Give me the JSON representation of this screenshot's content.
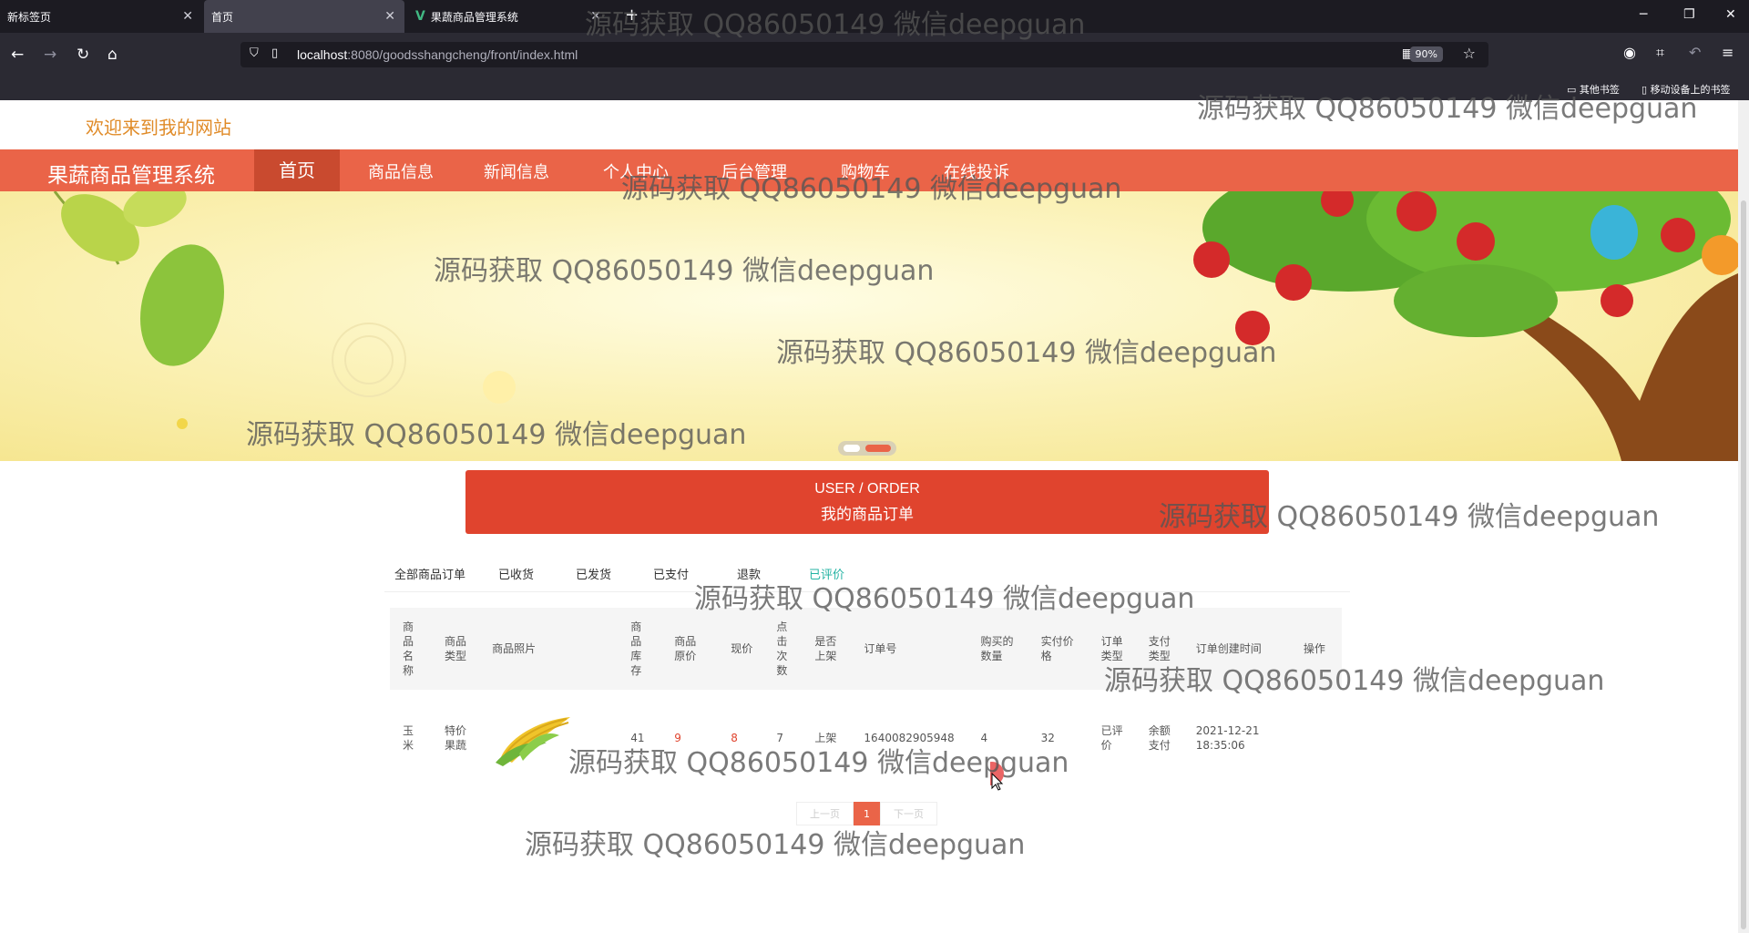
{
  "browser": {
    "tabs": [
      {
        "title": "新标签页"
      },
      {
        "title": "首页"
      },
      {
        "title": "果蔬商品管理系统"
      }
    ],
    "url_host": "localhost",
    "url_rest": ":8080/goodsshangcheng/front/index.html",
    "zoom": "90%",
    "bookmarks": [
      "其他书签",
      "移动设备上的书签"
    ]
  },
  "site": {
    "welcome": "欢迎来到我的网站",
    "brand": "果蔬商品管理系统",
    "menu": [
      "首页",
      "商品信息",
      "新闻信息",
      "个人中心",
      "后台管理",
      "购物车",
      "在线投诉"
    ],
    "active_menu_index": 0
  },
  "order_header": {
    "en": "USER / ORDER",
    "cn": "我的商品订单"
  },
  "status_tabs": [
    "全部商品订单",
    "已收货",
    "已发货",
    "已支付",
    "退款",
    "已评价"
  ],
  "active_status": "已评价",
  "table": {
    "headers": [
      "商品名称",
      "商品类型",
      "商品照片",
      "商品库存",
      "商品原价",
      "现价",
      "点击次数",
      "是否上架",
      "订单号",
      "购买的数量",
      "实付价格",
      "订单类型",
      "支付类型",
      "订单创建时间",
      "操作"
    ],
    "rows": [
      {
        "name": "玉米",
        "type": "特价果蔬",
        "photo": "corn-image",
        "stock": "41",
        "orig_price": "9",
        "price": "8",
        "clicks": "7",
        "on_shelf": "上架",
        "order_no": "1640082905948",
        "qty": "4",
        "paid": "32",
        "order_type": "已评价",
        "pay_type": "余额支付",
        "created": "2021-12-21 18:35:06",
        "action": ""
      }
    ]
  },
  "pager": {
    "prev": "上一页",
    "current": "1",
    "next": "下一页"
  },
  "watermark": "源码获取 QQ86050149 微信deepguan",
  "colors": {
    "accent": "#ea6448",
    "header_red": "#e0442e",
    "active_tab": "#24b3a3",
    "welcome": "#e08b28"
  }
}
